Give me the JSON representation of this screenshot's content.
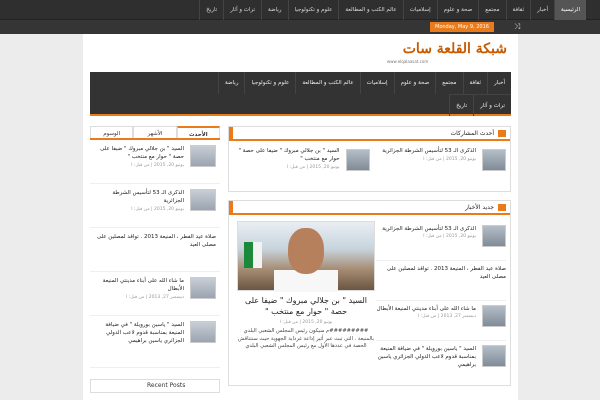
{
  "topnav": [
    "الرئيسية",
    "أخبار",
    "ثقافة",
    "مجتمع",
    "صحة و علوم",
    "إسلاميات",
    "عالم الكتب و المطالعة",
    "علوم و تكنولوجيا",
    "رياضة",
    "تراث و آثار",
    "تاريخ"
  ],
  "date": "Monday, May 9, 2016",
  "logo": {
    "text": "شبكة القلعة سات",
    "sub": "www.elqalaasat.com"
  },
  "mainnav_row1": [
    "أخبار",
    "ثقافة",
    "مجتمع",
    "صحة و علوم",
    "إسلاميات",
    "عالم الكتب و المطالعة",
    "علوم و تكنولوجيا",
    "رياضة"
  ],
  "mainnav_row2": [
    "تراث و آثار",
    "تاريخ"
  ],
  "sidebar": {
    "tabs": [
      "الأحدث",
      "الأشهر",
      "الوسوم"
    ],
    "items": [
      {
        "title": "السيد \" بن جلالي مبروك \" ضيفا على حصة \" حوار مع منتخب \"",
        "meta": "يونيو 20, 2015 | من قبل: ا",
        "thumb": true
      },
      {
        "title": "الذكرى الـ 53 لتأسيس الشرطة الجزائرية",
        "meta": "يونيو 20, 2015 | من قبل: ا",
        "thumb": true
      },
      {
        "title": "صلاة عيد الفطر ، المنيعة 2013 . تواقد لمصلين على مصلى العيد",
        "meta": "",
        "thumb": false
      },
      {
        "title": "ما شاء الله على أبناء مدينتي المنيعة الأبطال",
        "meta": "ديسمبر 27, 2013 | من قبل: ا",
        "thumb": true
      },
      {
        "title": "السيد \" ياسين بورويلة \" في ضيافة المنيعة بمناسبة قدوم لاعب الدولي الجزائري ياسين براهيمي",
        "meta": "",
        "thumb": true
      }
    ],
    "recent_label": "Recent Posts"
  },
  "featured": {
    "heading": "أحدث المشاركات",
    "items": [
      {
        "title": "الذكرى الـ 53 لتأسيس الشرطة الجزائرية",
        "meta": "يونيو 20, 2015 | من قبل: ا"
      },
      {
        "title": "السيد \" بن جلالي مبروك \" ضيفا على حصة \" حوار مع منتخب \"",
        "meta": "يونيو 20, 2015 | من قبل: ا"
      }
    ]
  },
  "news": {
    "heading": "جديد الأخبار",
    "big": {
      "title": "السيد \" بن جلالي مبروك \" ضيفا على حصة \" حوار مع منتخب \"",
      "meta": "يونيو 20, 2015 | من قبل: ا",
      "excerpt": "#########م سيكون رئيس المجلس الشعبي البلدي بالمنيعة . التي تبث عبر أثير إذاعة غرداية الجهوية حيث سنتناقش الحصة في عددها الأول مع رئيس المجلس الشعبي البلدي"
    },
    "items": [
      {
        "title": "الذكرى الـ 53 لتأسيس الشرطة الجزائرية",
        "meta": "يونيو 20, 2015 | من قبل: ا",
        "thumb": true
      },
      {
        "title": "صلاة عيد الفطر ، المنيعة 2013 . تواقد لمصلين على مصلى العيد",
        "meta": "",
        "thumb": false
      },
      {
        "title": "ما شاء الله على أبناء مدينتي المنيعة الأبطال",
        "meta": "ديسمبر 27, 2013 | من قبل: ا",
        "thumb": true
      },
      {
        "title": "السيد \" ياسين بورويلة \" في ضيافة المنيعة بمناسبة قدوم لاعب الدولي الجزائري ياسين براهيمي",
        "meta": "",
        "thumb": true
      }
    ]
  }
}
